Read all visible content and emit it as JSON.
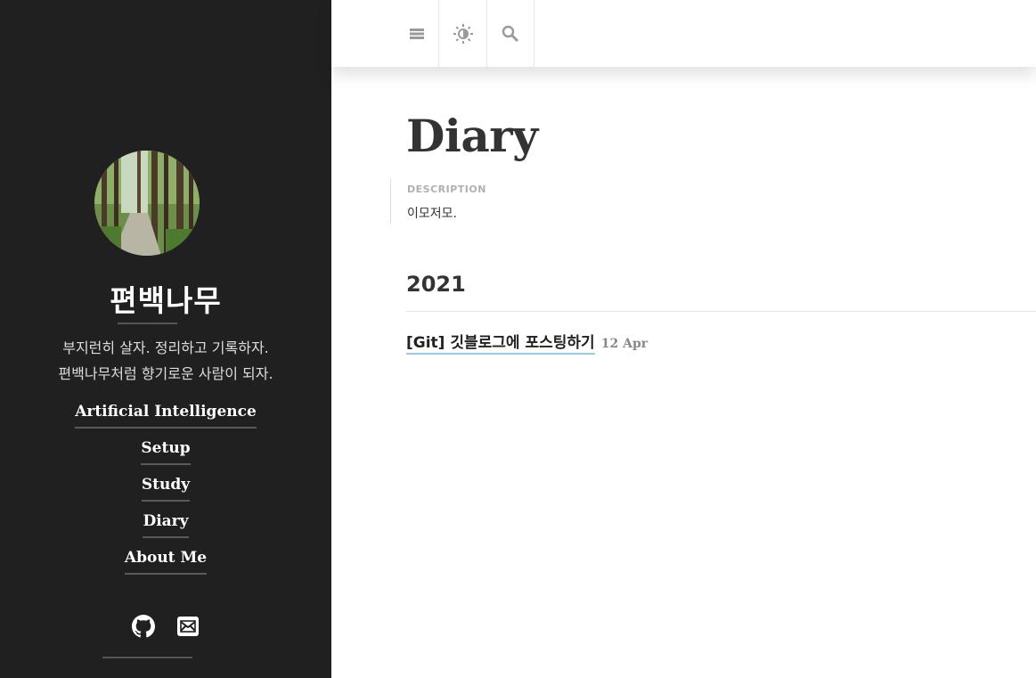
{
  "sidebar": {
    "title": "편백나무",
    "tagline_line1": "부지런히 살자. 정리하고 기록하자.",
    "tagline_line2": "편백나무처럼 향기로운 사람이 되자.",
    "nav": [
      {
        "label": "Artificial Intelligence"
      },
      {
        "label": "Setup"
      },
      {
        "label": "Study"
      },
      {
        "label": "Diary"
      },
      {
        "label": "About Me"
      }
    ],
    "social": [
      {
        "icon": "github-icon"
      },
      {
        "icon": "mail-icon"
      }
    ],
    "colors": {
      "background": "#202020",
      "text": "#ffffff"
    }
  },
  "topbar": {
    "buttons": [
      {
        "icon": "menu-icon"
      },
      {
        "icon": "theme-toggle-icon"
      },
      {
        "icon": "search-icon"
      }
    ]
  },
  "main": {
    "title": "Diary",
    "description_label": "DESCRIPTION",
    "description": "이모저모.",
    "groups": [
      {
        "year": "2021",
        "posts": [
          {
            "title": "[Git] 깃블로그에 포스팅하기",
            "date": "12 Apr"
          }
        ]
      }
    ],
    "colors": {
      "link_underline": "#9ccbe8",
      "text": "#333333",
      "date": "#888888"
    }
  }
}
